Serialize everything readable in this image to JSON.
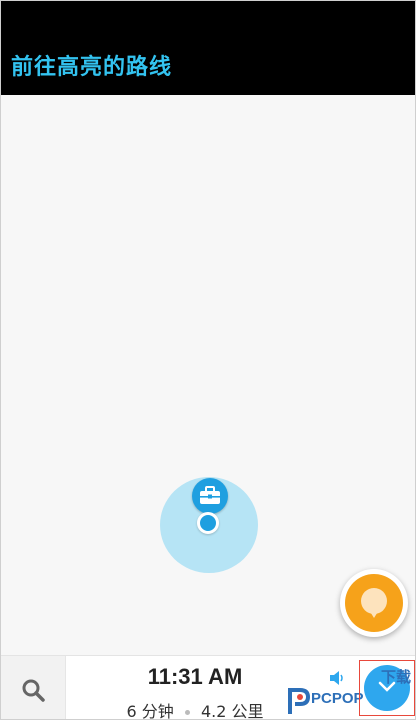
{
  "header": {
    "title": "前往高亮的路线"
  },
  "map": {
    "work_pin_icon": "briefcase-icon",
    "location_icon": "current-location-dot"
  },
  "report_button": {
    "icon": "report-pin-icon",
    "color": "#f6a21a"
  },
  "bottom_bar": {
    "search_icon": "search-icon",
    "eta_time": "11:31 AM",
    "duration": "6 分钟",
    "distance": "4.2 公里",
    "sound_icon": "sound-icon",
    "collapse_icon": "chevron-down-icon"
  },
  "watermark": {
    "text": "PCPOP",
    "suffix": "下载"
  },
  "colors": {
    "accent": "#33c3f0",
    "map_blue": "#1e9fe0",
    "header_bg": "#000000"
  }
}
